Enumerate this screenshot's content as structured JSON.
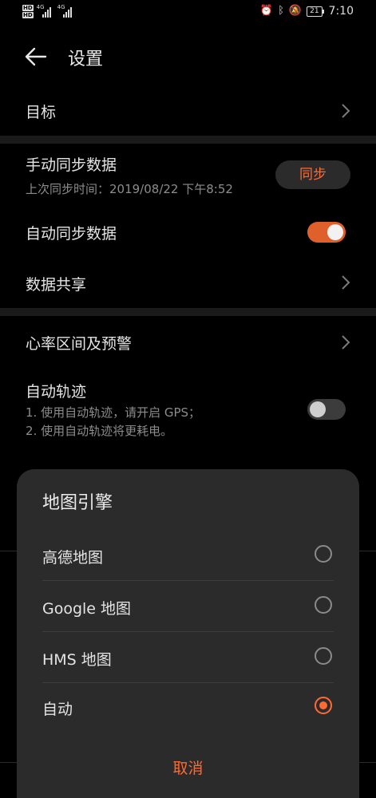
{
  "status_bar": {
    "hd_badge": "HD",
    "network_1": "4G",
    "network_2": "4G",
    "battery": "21",
    "time": "7:10",
    "icons": [
      "alarm-icon",
      "bluetooth-icon",
      "mute-icon",
      "battery-icon"
    ]
  },
  "header": {
    "back_icon": "arrow-left-icon",
    "title": "设置"
  },
  "settings": {
    "goal": {
      "label": "目标"
    },
    "manual_sync": {
      "label": "手动同步数据",
      "subtitle": "上次同步时间：2019/08/22 下午8:52",
      "button": "同步"
    },
    "auto_sync": {
      "label": "自动同步数据",
      "enabled": true
    },
    "data_share": {
      "label": "数据共享"
    },
    "heart_rate": {
      "label": "心率区间及预警"
    },
    "auto_track": {
      "label": "自动轨迹",
      "note_1": "1. 使用自动轨迹，请开启 GPS；",
      "note_2": "2. 使用自动轨迹将更耗电。",
      "enabled": false
    }
  },
  "dialog": {
    "title": "地图引擎",
    "options": [
      {
        "label": "高德地图",
        "selected": false
      },
      {
        "label": "Google 地图",
        "selected": false
      },
      {
        "label": "HMS 地图",
        "selected": false
      },
      {
        "label": "自动",
        "selected": true
      }
    ],
    "cancel": "取消"
  },
  "colors": {
    "accent": "#ff6a33",
    "background": "#000000",
    "dialog": "#2b2b2b"
  }
}
